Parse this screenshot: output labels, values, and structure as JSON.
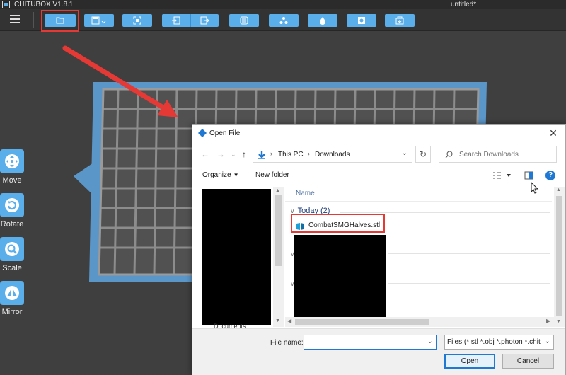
{
  "app": {
    "title": "CHITUBOX V1.8.1",
    "document": "untitled*",
    "accent": "#5aaeea"
  },
  "toolbar": {
    "buttons": [
      "menu-icon",
      "open-file-icon",
      "save-icon",
      "select-all-icon",
      "import-icon",
      "export-icon",
      "slice-settings-icon",
      "support-icon",
      "hollow-icon",
      "drill-icon",
      "print-icon"
    ]
  },
  "tools": [
    {
      "label": "Move",
      "icon": "move-icon"
    },
    {
      "label": "Rotate",
      "icon": "rotate-icon"
    },
    {
      "label": "Scale",
      "icon": "scale-icon"
    },
    {
      "label": "Mirror",
      "icon": "mirror-icon"
    }
  ],
  "dialog": {
    "title": "Open File",
    "close": "✕",
    "address": {
      "root": "This PC",
      "folder": "Downloads"
    },
    "search_placeholder": "Search Downloads",
    "organize": "Organize",
    "new_folder": "New folder",
    "column_name": "Name",
    "group_today": "Today (2)",
    "files": [
      "CombatSMGHalves.stl"
    ],
    "nav_partial_label": "Documents",
    "file_name_label": "File name:",
    "file_name_value": "",
    "file_types": "Files (*.stl *.obj *.photon *.chitubox)",
    "open_label": "Open",
    "cancel_label": "Cancel"
  }
}
